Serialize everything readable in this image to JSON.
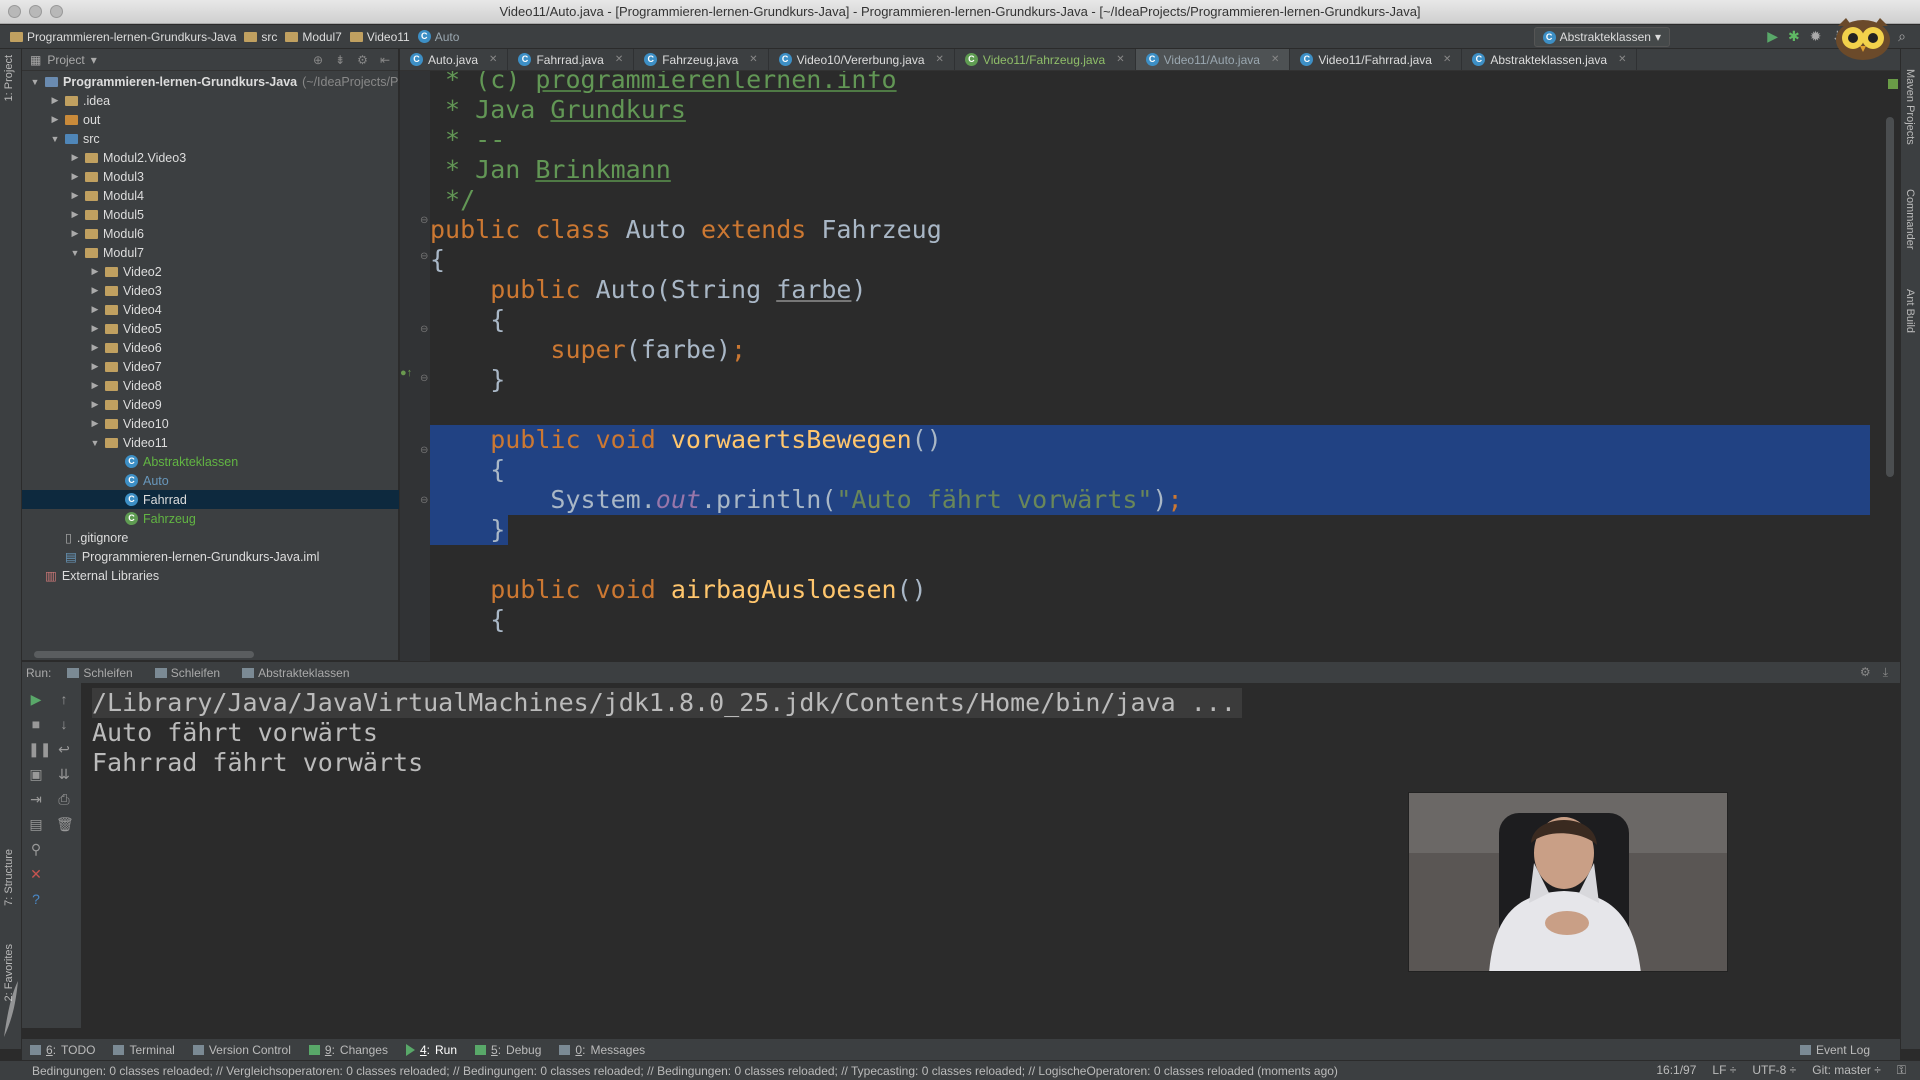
{
  "window": {
    "title": "Video11/Auto.java - [Programmieren-lernen-Grundkurs-Java] - Programmieren-lernen-Grundkurs-Java - [~/IdeaProjects/Programmieren-lernen-Grundkurs-Java]"
  },
  "breadcrumb": [
    {
      "label": "Programmieren-lernen-Grundkurs-Java",
      "icon": "project-folder-icon"
    },
    {
      "label": "src",
      "icon": "folder-icon"
    },
    {
      "label": "Modul7",
      "icon": "folder-icon"
    },
    {
      "label": "Video11",
      "icon": "folder-icon"
    },
    {
      "label": "Auto",
      "icon": "class-icon"
    }
  ],
  "toolbar": {
    "run_config": "Abstrakteklassen"
  },
  "project": {
    "header": "Project",
    "tree": [
      {
        "label": "Programmieren-lernen-Grundkurs-Java",
        "suffix": "(~/IdeaProjects/P",
        "depth": 0,
        "arrow": "down",
        "icon": "module",
        "bold": true
      },
      {
        "label": ".idea",
        "depth": 1,
        "arrow": "right",
        "icon": "folder"
      },
      {
        "label": "out",
        "depth": 1,
        "arrow": "right",
        "icon": "folder-orange"
      },
      {
        "label": "src",
        "depth": 1,
        "arrow": "down",
        "icon": "folder-blue"
      },
      {
        "label": "Modul2.Video3",
        "depth": 2,
        "arrow": "right",
        "icon": "package"
      },
      {
        "label": "Modul3",
        "depth": 2,
        "arrow": "right",
        "icon": "package"
      },
      {
        "label": "Modul4",
        "depth": 2,
        "arrow": "right",
        "icon": "package"
      },
      {
        "label": "Modul5",
        "depth": 2,
        "arrow": "right",
        "icon": "package"
      },
      {
        "label": "Modul6",
        "depth": 2,
        "arrow": "right",
        "icon": "package"
      },
      {
        "label": "Modul7",
        "depth": 2,
        "arrow": "down",
        "icon": "package"
      },
      {
        "label": "Video2",
        "depth": 3,
        "arrow": "right",
        "icon": "package"
      },
      {
        "label": "Video3",
        "depth": 3,
        "arrow": "right",
        "icon": "package"
      },
      {
        "label": "Video4",
        "depth": 3,
        "arrow": "right",
        "icon": "package"
      },
      {
        "label": "Video5",
        "depth": 3,
        "arrow": "right",
        "icon": "package"
      },
      {
        "label": "Video6",
        "depth": 3,
        "arrow": "right",
        "icon": "package"
      },
      {
        "label": "Video7",
        "depth": 3,
        "arrow": "right",
        "icon": "package"
      },
      {
        "label": "Video8",
        "depth": 3,
        "arrow": "right",
        "icon": "package"
      },
      {
        "label": "Video9",
        "depth": 3,
        "arrow": "right",
        "icon": "package"
      },
      {
        "label": "Video10",
        "depth": 3,
        "arrow": "right",
        "icon": "package"
      },
      {
        "label": "Video11",
        "depth": 3,
        "arrow": "down",
        "icon": "package"
      },
      {
        "label": "Abstrakteklassen",
        "depth": 4,
        "arrow": "",
        "icon": "class",
        "color": "green"
      },
      {
        "label": "Auto",
        "depth": 4,
        "arrow": "",
        "icon": "class",
        "color": "blue"
      },
      {
        "label": "Fahrrad",
        "depth": 4,
        "arrow": "",
        "icon": "class",
        "selected": true
      },
      {
        "label": "Fahrzeug",
        "depth": 4,
        "arrow": "",
        "icon": "abstract-class",
        "color": "green"
      },
      {
        "label": ".gitignore",
        "depth": 1,
        "arrow": "",
        "icon": "file"
      },
      {
        "label": "Programmieren-lernen-Grundkurs-Java.iml",
        "depth": 1,
        "arrow": "",
        "icon": "iml"
      },
      {
        "label": "External Libraries",
        "depth": 0,
        "arrow": "",
        "icon": "library"
      }
    ]
  },
  "tabs": [
    {
      "label": "Auto.java",
      "state": "normal"
    },
    {
      "label": "Fahrrad.java",
      "state": "normal"
    },
    {
      "label": "Fahrzeug.java",
      "state": "normal"
    },
    {
      "label": "Video10/Vererbung.java",
      "state": "normal"
    },
    {
      "label": "Video11/Fahrzeug.java",
      "state": "green"
    },
    {
      "label": "Video11/Auto.java",
      "state": "active"
    },
    {
      "label": "Video11/Fahrrad.java",
      "state": "normal"
    },
    {
      "label": "Abstrakteklassen.java",
      "state": "normal"
    }
  ],
  "code": {
    "lines": [
      {
        "hl": false,
        "parts": [
          {
            "t": " * (c) ",
            "c": "cm"
          },
          {
            "t": "programmierenlernen.info",
            "c": "cmu"
          }
        ]
      },
      {
        "hl": false,
        "parts": [
          {
            "t": " * Java ",
            "c": "cm"
          },
          {
            "t": "Grundkurs",
            "c": "cmu"
          }
        ]
      },
      {
        "hl": false,
        "parts": [
          {
            "t": " * --",
            "c": "cm"
          }
        ]
      },
      {
        "hl": false,
        "parts": [
          {
            "t": " * Jan ",
            "c": "cm"
          },
          {
            "t": "Brinkmann",
            "c": "cmu"
          }
        ]
      },
      {
        "hl": false,
        "parts": [
          {
            "t": " */",
            "c": "cm"
          }
        ]
      },
      {
        "hl": false,
        "parts": [
          {
            "t": "public class ",
            "c": "kw"
          },
          {
            "t": "Auto ",
            "c": ""
          },
          {
            "t": "extends ",
            "c": "kw"
          },
          {
            "t": "Fahrzeug",
            "c": ""
          }
        ]
      },
      {
        "hl": false,
        "parts": [
          {
            "t": "{",
            "c": ""
          }
        ]
      },
      {
        "hl": false,
        "parts": [
          {
            "t": "    public ",
            "c": "kw"
          },
          {
            "t": "Auto(String ",
            "c": ""
          },
          {
            "t": "farbe",
            "c": "pm"
          },
          {
            "t": ")",
            "c": ""
          }
        ]
      },
      {
        "hl": false,
        "parts": [
          {
            "t": "    {",
            "c": ""
          }
        ]
      },
      {
        "hl": false,
        "parts": [
          {
            "t": "        super",
            "c": "kw"
          },
          {
            "t": "(farbe)",
            "c": ""
          },
          {
            "t": ";",
            "c": "kw"
          }
        ]
      },
      {
        "hl": false,
        "parts": [
          {
            "t": "    }",
            "c": ""
          }
        ]
      },
      {
        "hl": false,
        "parts": [
          {
            "t": "",
            "c": ""
          }
        ]
      },
      {
        "hl": true,
        "parts": [
          {
            "t": "    public void ",
            "c": "kw"
          },
          {
            "t": "vorwaertsBewegen",
            "c": "fn"
          },
          {
            "t": "()",
            "c": ""
          }
        ]
      },
      {
        "hl": true,
        "parts": [
          {
            "t": "    {",
            "c": ""
          }
        ]
      },
      {
        "hl": true,
        "parts": [
          {
            "t": "        System.",
            "c": ""
          },
          {
            "t": "out",
            "c": "it"
          },
          {
            "t": ".println(",
            "c": ""
          },
          {
            "t": "\"Auto fährt vorwärts\"",
            "c": "str"
          },
          {
            "t": ")",
            "c": ""
          },
          {
            "t": ";",
            "c": "kw"
          }
        ]
      },
      {
        "hl": true,
        "parts": [
          {
            "t": "    }",
            "c": ""
          }
        ],
        "partial": true
      },
      {
        "hl": false,
        "parts": [
          {
            "t": "",
            "c": ""
          }
        ]
      },
      {
        "hl": false,
        "parts": [
          {
            "t": "    public void ",
            "c": "kw"
          },
          {
            "t": "airbagAusloesen",
            "c": "fn"
          },
          {
            "t": "()",
            "c": ""
          }
        ]
      },
      {
        "hl": false,
        "parts": [
          {
            "t": "    {",
            "c": ""
          }
        ]
      }
    ]
  },
  "run": {
    "label": "Run:",
    "tabs": [
      "Schleifen",
      "Schleifen",
      "Abstrakteklassen"
    ],
    "output": [
      "/Library/Java/JavaVirtualMachines/jdk1.8.0_25.jdk/Contents/Home/bin/java ...",
      "Auto fährt vorwärts",
      "Fahrrad fährt vorwärts"
    ]
  },
  "side_tabs": {
    "left": [
      "1: Project",
      "7: Structure",
      "2: Favorites"
    ],
    "right": [
      "Maven Projects",
      "Commander",
      "Ant Build"
    ]
  },
  "bottom_tabs": [
    {
      "key": "6",
      "label": "TODO"
    },
    {
      "key": "",
      "label": "Terminal"
    },
    {
      "key": "",
      "label": "Version Control"
    },
    {
      "key": "9",
      "label": "Changes"
    },
    {
      "key": "4",
      "label": "Run",
      "active": true
    },
    {
      "key": "5",
      "label": "Debug"
    },
    {
      "key": "0",
      "label": "Messages"
    }
  ],
  "event_log": "Event Log",
  "status": {
    "message": "Bedingungen: 0 classes reloaded; // Vergleichsoperatoren: 0 classes reloaded; // Bedingungen: 0 classes reloaded; // Bedingungen: 0 classes reloaded; // Typecasting: 0 classes reloaded; // LogischeOperatoren: 0 classes reloaded (moments ago)",
    "position": "16:1/97",
    "line_sep": "LF ÷",
    "encoding": "UTF-8 ÷",
    "vcs": "Git: master ÷"
  },
  "colors": {
    "bg": "#2b2b2b",
    "panel": "#3c3f41",
    "selection": "#214283",
    "keyword": "#cc7832",
    "string": "#6a8759",
    "comment": "#629755"
  }
}
